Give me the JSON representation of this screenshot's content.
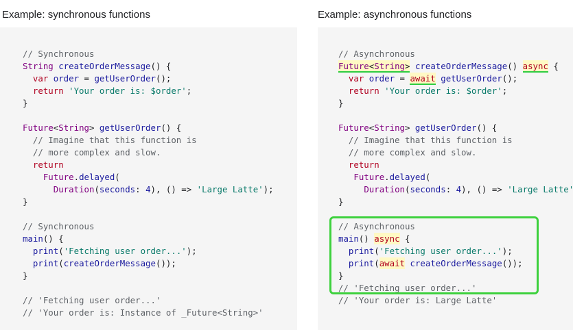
{
  "left": {
    "heading": "Example: synchronous functions",
    "lines": [
      [
        [
          "c",
          "// Synchronous"
        ]
      ],
      [
        [
          "t",
          "String "
        ],
        [
          "f",
          "createOrderMessage"
        ],
        [
          "p",
          "() {"
        ]
      ],
      [
        [
          "p",
          "  "
        ],
        [
          "k",
          "var "
        ],
        [
          "f",
          "order"
        ],
        [
          "p",
          " = "
        ],
        [
          "f",
          "getUserOrder"
        ],
        [
          "p",
          "();"
        ]
      ],
      [
        [
          "p",
          "  "
        ],
        [
          "k",
          "return "
        ],
        [
          "s",
          "'Your order is: $order'"
        ],
        [
          "p",
          ";"
        ]
      ],
      [
        [
          "p",
          "}"
        ]
      ],
      [
        [
          "p",
          ""
        ]
      ],
      [
        [
          "t",
          "Future"
        ],
        [
          "p",
          "<"
        ],
        [
          "t",
          "String"
        ],
        [
          "p",
          "> "
        ],
        [
          "f",
          "getUserOrder"
        ],
        [
          "p",
          "() {"
        ]
      ],
      [
        [
          "c",
          "  // Imagine that this function is"
        ]
      ],
      [
        [
          "c",
          "  // more complex and slow."
        ]
      ],
      [
        [
          "p",
          "  "
        ],
        [
          "k",
          "return"
        ]
      ],
      [
        [
          "p",
          "    "
        ],
        [
          "t",
          "Future"
        ],
        [
          "p",
          "."
        ],
        [
          "f",
          "delayed"
        ],
        [
          "p",
          "("
        ]
      ],
      [
        [
          "p",
          "      "
        ],
        [
          "t",
          "Duration"
        ],
        [
          "p",
          "("
        ],
        [
          "f",
          "seconds"
        ],
        [
          "p",
          ": "
        ],
        [
          "n",
          "4"
        ],
        [
          "p",
          "), () => "
        ],
        [
          "s",
          "'Large Latte'"
        ],
        [
          "p",
          ");"
        ]
      ],
      [
        [
          "p",
          "}"
        ]
      ],
      [
        [
          "p",
          ""
        ]
      ],
      [
        [
          "c",
          "// Synchronous"
        ]
      ],
      [
        [
          "f",
          "main"
        ],
        [
          "p",
          "() {"
        ]
      ],
      [
        [
          "p",
          "  "
        ],
        [
          "f",
          "print"
        ],
        [
          "p",
          "("
        ],
        [
          "s",
          "'Fetching user order...'"
        ],
        [
          "p",
          ");"
        ]
      ],
      [
        [
          "p",
          "  "
        ],
        [
          "f",
          "print"
        ],
        [
          "p",
          "("
        ],
        [
          "f",
          "createOrderMessage"
        ],
        [
          "p",
          "());"
        ]
      ],
      [
        [
          "p",
          "}"
        ]
      ],
      [
        [
          "p",
          ""
        ]
      ],
      [
        [
          "c",
          "// 'Fetching user order...'"
        ]
      ],
      [
        [
          "c",
          "// 'Your order is: Instance of _Future<String>'"
        ]
      ]
    ]
  },
  "right": {
    "heading": "Example: asynchronous functions",
    "lines": [
      [
        [
          "c",
          "// Asynchronous"
        ]
      ],
      [
        [
          "t",
          "Future",
          "hl ul"
        ],
        [
          "p",
          "<",
          "hl ul"
        ],
        [
          "t",
          "String",
          "hl ul"
        ],
        [
          "p",
          ">",
          "hl ul"
        ],
        [
          "p",
          " "
        ],
        [
          "f",
          "createOrderMessage"
        ],
        [
          "p",
          "() "
        ],
        [
          "k",
          "async",
          "hl ul"
        ],
        [
          "p",
          " {"
        ]
      ],
      [
        [
          "p",
          "  "
        ],
        [
          "k",
          "var "
        ],
        [
          "f",
          "order"
        ],
        [
          "p",
          " = "
        ],
        [
          "k",
          "await",
          "hl ul"
        ],
        [
          "p",
          " "
        ],
        [
          "f",
          "getUserOrder"
        ],
        [
          "p",
          "();"
        ]
      ],
      [
        [
          "p",
          "  "
        ],
        [
          "k",
          "return "
        ],
        [
          "s",
          "'Your order is: $order'"
        ],
        [
          "p",
          ";"
        ]
      ],
      [
        [
          "p",
          "}"
        ]
      ],
      [
        [
          "p",
          ""
        ]
      ],
      [
        [
          "t",
          "Future"
        ],
        [
          "p",
          "<"
        ],
        [
          "t",
          "String"
        ],
        [
          "p",
          "> "
        ],
        [
          "f",
          "getUserOrder"
        ],
        [
          "p",
          "() {"
        ]
      ],
      [
        [
          "c",
          "  // Imagine that this function is"
        ]
      ],
      [
        [
          "c",
          "  // more complex and slow."
        ]
      ],
      [
        [
          "p",
          "  "
        ],
        [
          "k",
          "return"
        ]
      ],
      [
        [
          "p",
          "   "
        ],
        [
          "t",
          "Future"
        ],
        [
          "p",
          "."
        ],
        [
          "f",
          "delayed"
        ],
        [
          "p",
          "("
        ]
      ],
      [
        [
          "p",
          "     "
        ],
        [
          "t",
          "Duration"
        ],
        [
          "p",
          "("
        ],
        [
          "f",
          "seconds"
        ],
        [
          "p",
          ": "
        ],
        [
          "n",
          "4"
        ],
        [
          "p",
          "), () => "
        ],
        [
          "s",
          "'Large Latte'"
        ],
        [
          "p",
          ");"
        ]
      ],
      [
        [
          "p",
          "}"
        ]
      ],
      [
        [
          "p",
          ""
        ]
      ],
      [
        [
          "c",
          "// Asynchronous"
        ]
      ],
      [
        [
          "f",
          "main"
        ],
        [
          "p",
          "() "
        ],
        [
          "k",
          "async",
          "hl"
        ],
        [
          "p",
          " {"
        ]
      ],
      [
        [
          "p",
          "  "
        ],
        [
          "f",
          "print"
        ],
        [
          "p",
          "("
        ],
        [
          "s",
          "'Fetching user order...'"
        ],
        [
          "p",
          ");"
        ]
      ],
      [
        [
          "p",
          "  "
        ],
        [
          "f",
          "print"
        ],
        [
          "p",
          "("
        ],
        [
          "k",
          "await",
          "hl"
        ],
        [
          "p",
          " "
        ],
        [
          "f",
          "createOrderMessage"
        ],
        [
          "p",
          "());"
        ]
      ],
      [
        [
          "p",
          "}"
        ]
      ],
      [
        [
          "c",
          "// 'Fetching user order...'"
        ]
      ],
      [
        [
          "c",
          "// 'Your order is: Large Latte'"
        ]
      ]
    ]
  },
  "colors": {
    "highlight_border": "#3dd13d",
    "underline": "#2ecc40",
    "panel_bg": "#f5f5f5"
  }
}
